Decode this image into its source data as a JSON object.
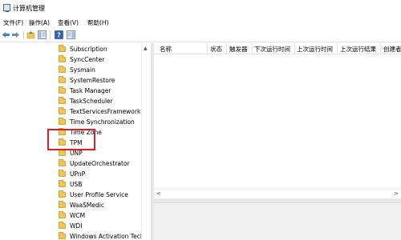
{
  "window": {
    "title": "计算机管理"
  },
  "menu": {
    "items": [
      {
        "label": "文件(F)"
      },
      {
        "label": "操作(A)"
      },
      {
        "label": "查看(V)"
      },
      {
        "label": "帮助(H)"
      }
    ]
  },
  "toolbar": {
    "buttons": [
      {
        "icon": "back-arrow-icon"
      },
      {
        "icon": "forward-arrow-icon"
      },
      {
        "icon": "folder-up-icon"
      },
      {
        "icon": "show-hide-console-tree-icon"
      },
      {
        "icon": "help-icon"
      },
      {
        "icon": "action-pane-icon"
      }
    ]
  },
  "tree": {
    "items": [
      {
        "label": "Subscription"
      },
      {
        "label": "SyncCenter"
      },
      {
        "label": "Sysmain"
      },
      {
        "label": "SystemRestore"
      },
      {
        "label": "Task Manager"
      },
      {
        "label": "TaskScheduler"
      },
      {
        "label": "TextServicesFramework"
      },
      {
        "label": "Time Synchronization"
      },
      {
        "label": "Time Zone"
      },
      {
        "label": "TPM"
      },
      {
        "label": "UNP"
      },
      {
        "label": "UpdateOrchestrator"
      },
      {
        "label": "UPnP"
      },
      {
        "label": "USB"
      },
      {
        "label": "User Profile Service"
      },
      {
        "label": "WaaSMedic"
      },
      {
        "label": "WCM"
      },
      {
        "label": "WDI"
      },
      {
        "label": "Windows Activation Tech"
      }
    ],
    "highlight_color": "#e01e24",
    "folder_color": "#f0c65a"
  },
  "list": {
    "columns": [
      {
        "label": "名称"
      },
      {
        "label": "状态"
      },
      {
        "label": "触发器"
      },
      {
        "label": "下次运行时间"
      },
      {
        "label": "上次运行时间"
      },
      {
        "label": "上次运行结果"
      },
      {
        "label": "创建者"
      }
    ]
  }
}
